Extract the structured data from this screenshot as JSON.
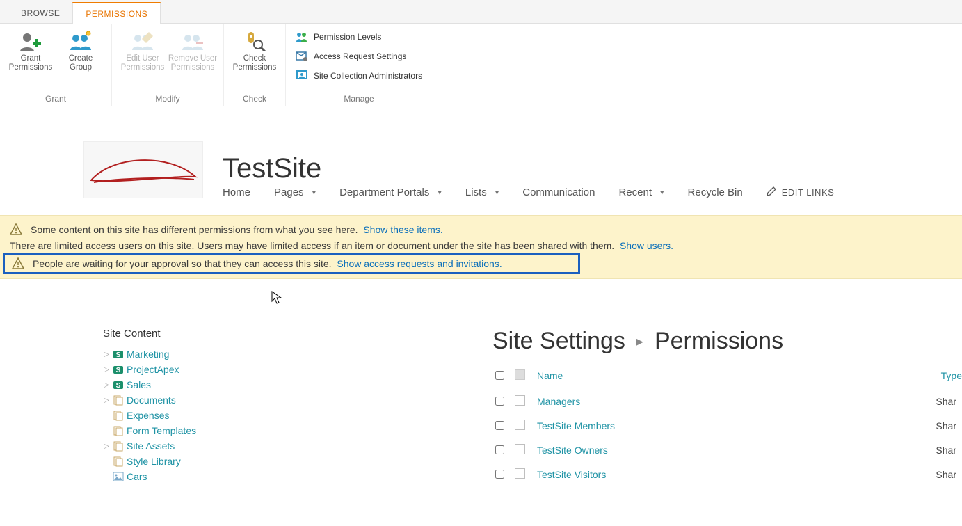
{
  "tabs": {
    "browse": "BROWSE",
    "permissions": "PERMISSIONS"
  },
  "ribbon": {
    "grant": {
      "label": "Grant",
      "grant_btn": "Grant\nPermissions",
      "create_group_btn": "Create\nGroup"
    },
    "modify": {
      "label": "Modify",
      "edit_user_btn": "Edit User\nPermissions",
      "remove_user_btn": "Remove User\nPermissions"
    },
    "check": {
      "label": "Check",
      "check_btn": "Check\nPermissions"
    },
    "manage": {
      "label": "Manage",
      "perm_levels": "Permission Levels",
      "access_req": "Access Request Settings",
      "site_admins": "Site Collection Administrators"
    }
  },
  "site": {
    "title": "TestSite",
    "nav": {
      "home": "Home",
      "pages": "Pages",
      "dept": "Department Portals",
      "lists": "Lists",
      "comm": "Communication",
      "recent": "Recent",
      "recycle": "Recycle Bin",
      "edit_links": "EDIT LINKS"
    }
  },
  "notices": {
    "n1_text": "Some content on this site has different permissions from what you see here.",
    "n1_link": "Show these items.",
    "n2_text": "There are limited access users on this site. Users may have limited access if an item or document under the site has been shared with them.",
    "n2_link": "Show users.",
    "n3_text": "People are waiting for your approval so that they can access this site.",
    "n3_link": "Show access requests and invitations."
  },
  "left": {
    "title": "Site Content",
    "items": [
      {
        "label": "Marketing",
        "icon": "site",
        "exp": true
      },
      {
        "label": "ProjectApex",
        "icon": "site",
        "exp": true
      },
      {
        "label": "Sales",
        "icon": "site",
        "exp": true
      },
      {
        "label": "Documents",
        "icon": "lib",
        "exp": true
      },
      {
        "label": "Expenses",
        "icon": "lib",
        "exp": false
      },
      {
        "label": "Form Templates",
        "icon": "lib",
        "exp": false
      },
      {
        "label": "Site Assets",
        "icon": "lib",
        "exp": true
      },
      {
        "label": "Style Library",
        "icon": "lib",
        "exp": false
      },
      {
        "label": "Cars",
        "icon": "pic",
        "exp": false
      }
    ]
  },
  "main": {
    "bc1": "Site Settings",
    "bc2": "Permissions",
    "cols": {
      "name": "Name",
      "type": "Type"
    },
    "rows": [
      {
        "name": "Managers",
        "type": "Shar"
      },
      {
        "name": "TestSite Members",
        "type": "Shar"
      },
      {
        "name": "TestSite Owners",
        "type": "Shar"
      },
      {
        "name": "TestSite Visitors",
        "type": "Shar"
      }
    ]
  }
}
